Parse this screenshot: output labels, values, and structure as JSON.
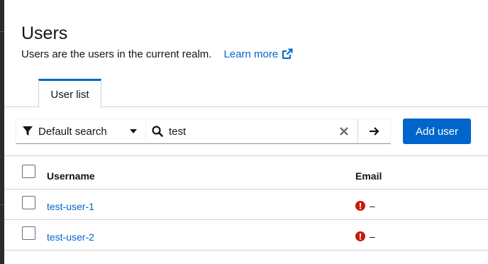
{
  "header": {
    "title": "Users",
    "subtitle": "Users are the users in the current realm.",
    "learn_more": "Learn more"
  },
  "tabs": [
    {
      "label": "User list",
      "active": true
    }
  ],
  "toolbar": {
    "filter_label": "Default search",
    "search_value": "test",
    "add_user_label": "Add user"
  },
  "table": {
    "columns": [
      "Username",
      "Email"
    ],
    "rows": [
      {
        "username": "test-user-1",
        "email": "–",
        "email_status": "error-icon"
      },
      {
        "username": "test-user-2",
        "email": "–",
        "email_status": "error-icon"
      }
    ]
  },
  "colors": {
    "accent": "#0066cc",
    "error": "#c9190b",
    "border": "#d2d2d2"
  }
}
